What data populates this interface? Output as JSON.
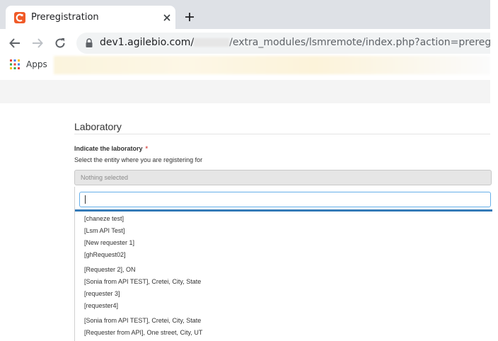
{
  "browser": {
    "tab_title": "Preregistration",
    "url_host": "dev1.agilebio.com/",
    "url_rest": "/extra_modules/lsmremote/index.php?action=preregister",
    "bookmarks_apps_label": "Apps"
  },
  "form": {
    "section_title": "Laboratory",
    "field_label": "Indicate the laboratory",
    "required_mark": "*",
    "field_help": "Select the entity where you are registering for",
    "select_placeholder": "Nothing selected",
    "search_value": ""
  },
  "options": [
    "[chaneze test]",
    "[Lsm API Test]",
    "[New requester 1]",
    "[ghRequest02]",
    "[Requester 2], ON",
    "[Sonia from API TEST], Cretei, City, State",
    "[requester 3]",
    "[requester4]",
    "[Sonia from API TEST], Cretei, City, State",
    "[Requester from API], One street, City, UT"
  ],
  "colors": {
    "accent": "#337ab7",
    "brand": "#f05a28",
    "required": "#d9534f"
  }
}
